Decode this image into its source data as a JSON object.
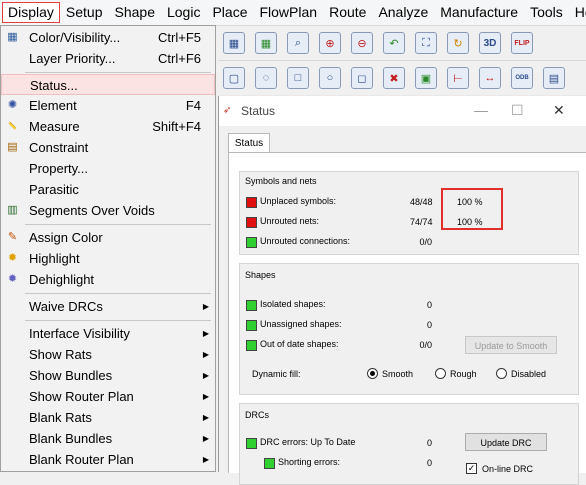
{
  "menubar": {
    "items": [
      "Display",
      "Setup",
      "Shape",
      "Logic",
      "Place",
      "FlowPlan",
      "Route",
      "Analyze",
      "Manufacture",
      "Tools",
      "Help"
    ]
  },
  "toolbar": {
    "row1_icons": [
      "grid-icon",
      "grid-icon",
      "zoom-fit-icon",
      "zoom-in-icon",
      "zoom-out-icon",
      "zoom-previous-icon",
      "zoom-world-icon",
      "redraw-icon",
      "3d-view-icon",
      "flip-icon"
    ],
    "three_d_label": "3D",
    "flip_label": "FLIP",
    "odb_label": "ODB"
  },
  "display_menu": {
    "items": [
      {
        "label": "Color/Visibility...",
        "shortcut": "Ctrl+F5",
        "icon": "color-grid-icon"
      },
      {
        "label": "Layer Priority...",
        "shortcut": "Ctrl+F6",
        "icon": ""
      },
      {
        "label": "Status...",
        "shortcut": "",
        "icon": ""
      },
      {
        "label": "Element",
        "shortcut": "F4",
        "icon": "element-icon"
      },
      {
        "label": "Measure",
        "shortcut": "Shift+F4",
        "icon": "measure-icon"
      },
      {
        "label": "Constraint",
        "shortcut": "",
        "icon": "constraint-icon"
      },
      {
        "label": "Property...",
        "shortcut": "",
        "icon": ""
      },
      {
        "label": "Parasitic",
        "shortcut": "",
        "icon": ""
      },
      {
        "label": "Segments Over Voids",
        "shortcut": "",
        "icon": "segments-icon"
      },
      {
        "label": "Assign Color",
        "shortcut": "",
        "icon": "paint-icon"
      },
      {
        "label": "Highlight",
        "shortcut": "",
        "icon": "highlight-icon"
      },
      {
        "label": "Dehighlight",
        "shortcut": "",
        "icon": "dehighlight-icon"
      },
      {
        "label": "Waive DRCs",
        "shortcut": "",
        "icon": ""
      },
      {
        "label": "Interface Visibility",
        "shortcut": "",
        "icon": ""
      },
      {
        "label": "Show Rats",
        "shortcut": "",
        "icon": ""
      },
      {
        "label": "Show Bundles",
        "shortcut": "",
        "icon": ""
      },
      {
        "label": "Show Router Plan",
        "shortcut": "",
        "icon": ""
      },
      {
        "label": "Blank Rats",
        "shortcut": "",
        "icon": ""
      },
      {
        "label": "Blank Bundles",
        "shortcut": "",
        "icon": ""
      },
      {
        "label": "Blank Router Plan",
        "shortcut": "",
        "icon": ""
      }
    ]
  },
  "dialog": {
    "title": "Status",
    "tab": "Status",
    "symbols_nets": {
      "header": "Symbols and nets",
      "rows": [
        {
          "label": "Unplaced symbols:",
          "count": "48/48",
          "pct": "100 %",
          "color": "#e01010"
        },
        {
          "label": "Unrouted nets:",
          "count": "74/74",
          "pct": "100 %",
          "color": "#e01010"
        },
        {
          "label": "Unrouted connections:",
          "count": "0/0",
          "pct": "",
          "color": "#30d030"
        }
      ]
    },
    "shapes": {
      "header": "Shapes",
      "rows": [
        {
          "label": "Isolated shapes:",
          "count": "0"
        },
        {
          "label": "Unassigned shapes:",
          "count": "0"
        },
        {
          "label": "Out of date shapes:",
          "count": "0/0"
        }
      ],
      "update_button": "Update to Smooth",
      "dynamic_fill_label": "Dynamic fill:",
      "options": [
        "Smooth",
        "Rough",
        "Disabled"
      ],
      "selected": "Smooth"
    },
    "drcs": {
      "header": "DRCs",
      "rows": [
        {
          "label": "DRC errors: Up To Date",
          "count": "0"
        },
        {
          "label": "Shorting errors:",
          "count": "0"
        }
      ],
      "update_button": "Update DRC",
      "online_label": "On-line DRC",
      "online_checked": true
    }
  }
}
